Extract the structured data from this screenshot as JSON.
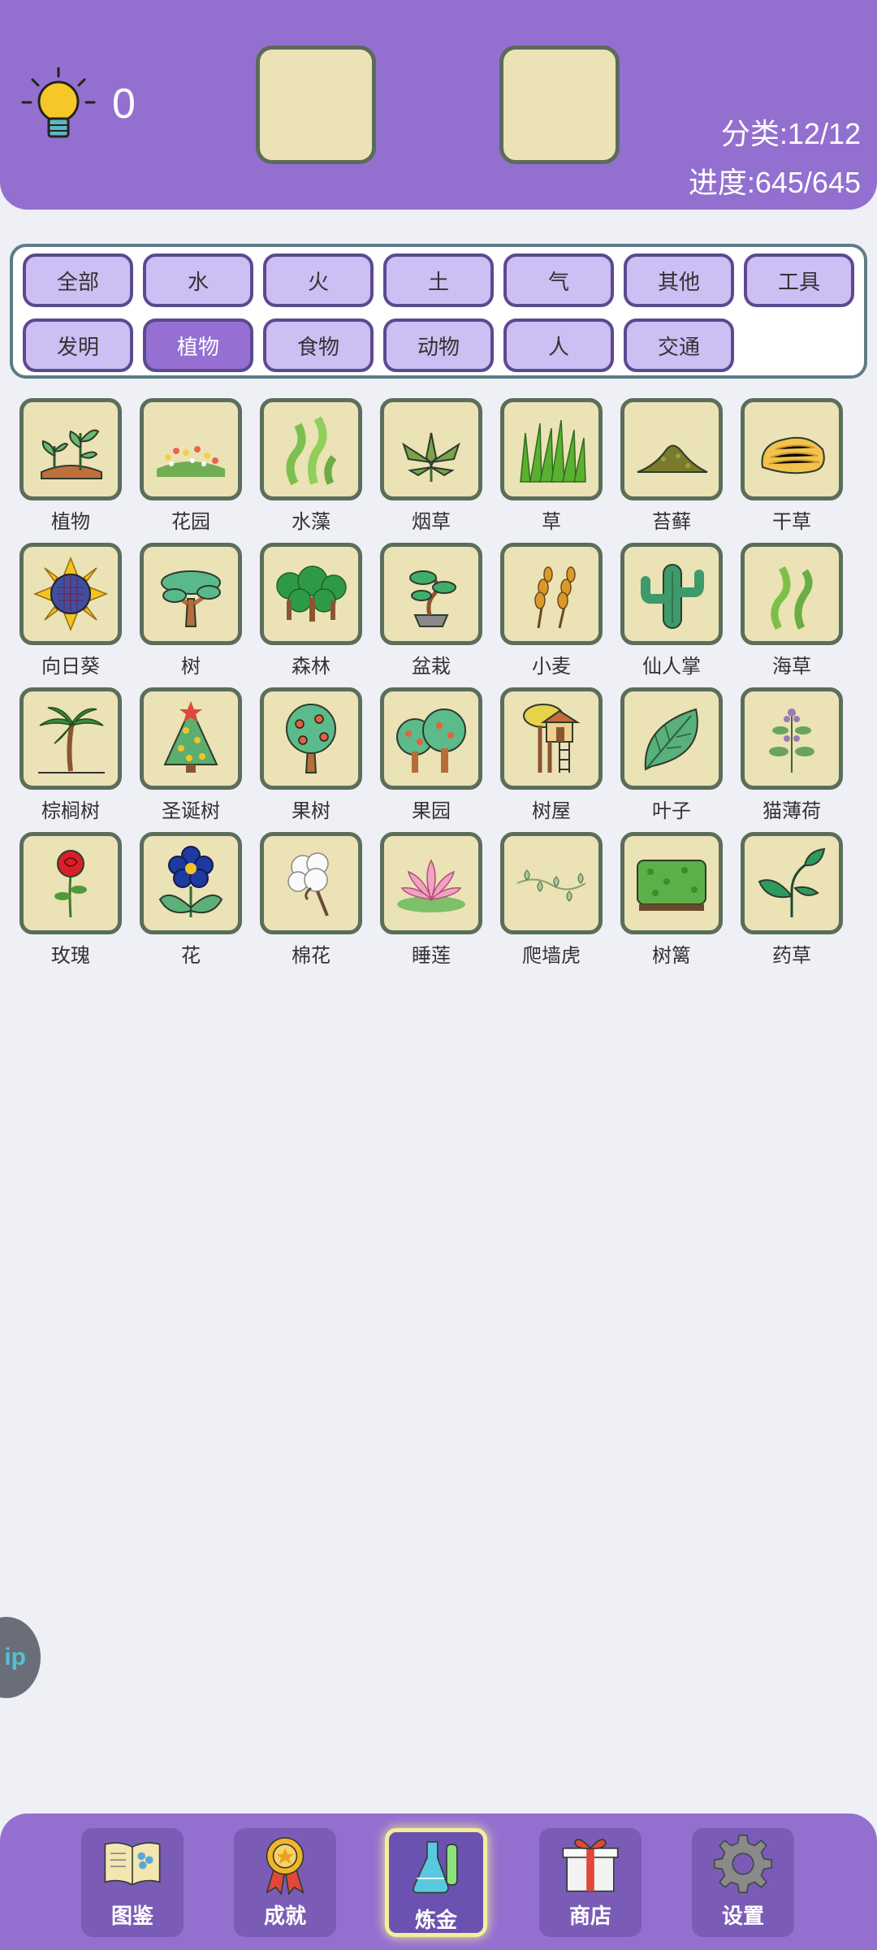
{
  "header": {
    "hint_count": "0",
    "category_stat": "分类:12/12",
    "progress_stat": "进度:645/645"
  },
  "filters": [
    {
      "label": "全部",
      "active": false
    },
    {
      "label": "水",
      "active": false
    },
    {
      "label": "火",
      "active": false
    },
    {
      "label": "土",
      "active": false
    },
    {
      "label": "气",
      "active": false
    },
    {
      "label": "其他",
      "active": false
    },
    {
      "label": "工具",
      "active": false
    },
    {
      "label": "发明",
      "active": false
    },
    {
      "label": "植物",
      "active": true
    },
    {
      "label": "食物",
      "active": false
    },
    {
      "label": "动物",
      "active": false
    },
    {
      "label": "人",
      "active": false
    },
    {
      "label": "交通",
      "active": false
    }
  ],
  "items": [
    {
      "label": "植物",
      "icon": "plant-sprouts-icon"
    },
    {
      "label": "花园",
      "icon": "flower-garden-icon"
    },
    {
      "label": "水藻",
      "icon": "algae-icon"
    },
    {
      "label": "烟草",
      "icon": "tobacco-leaf-icon"
    },
    {
      "label": "草",
      "icon": "grass-icon"
    },
    {
      "label": "苔藓",
      "icon": "moss-mound-icon"
    },
    {
      "label": "干草",
      "icon": "hay-icon"
    },
    {
      "label": "向日葵",
      "icon": "sunflower-icon"
    },
    {
      "label": "树",
      "icon": "tree-icon"
    },
    {
      "label": "森林",
      "icon": "forest-icon"
    },
    {
      "label": "盆栽",
      "icon": "bonsai-icon"
    },
    {
      "label": "小麦",
      "icon": "wheat-icon"
    },
    {
      "label": "仙人掌",
      "icon": "cactus-icon"
    },
    {
      "label": "海草",
      "icon": "seaweed-icon"
    },
    {
      "label": "棕榈树",
      "icon": "palm-tree-icon"
    },
    {
      "label": "圣诞树",
      "icon": "christmas-tree-icon"
    },
    {
      "label": "果树",
      "icon": "fruit-tree-icon"
    },
    {
      "label": "果园",
      "icon": "orchard-icon"
    },
    {
      "label": "树屋",
      "icon": "treehouse-icon"
    },
    {
      "label": "叶子",
      "icon": "leaf-icon"
    },
    {
      "label": "猫薄荷",
      "icon": "catnip-icon"
    },
    {
      "label": "玫瑰",
      "icon": "rose-icon"
    },
    {
      "label": "花",
      "icon": "flower-icon"
    },
    {
      "label": "棉花",
      "icon": "cotton-icon"
    },
    {
      "label": "睡莲",
      "icon": "water-lily-icon"
    },
    {
      "label": "爬墙虎",
      "icon": "ivy-vine-icon"
    },
    {
      "label": "树篱",
      "icon": "hedge-icon"
    },
    {
      "label": "药草",
      "icon": "herb-icon"
    }
  ],
  "floating_button": {
    "text": "ip"
  },
  "bottom_nav": [
    {
      "label": "图鉴",
      "icon": "book-icon",
      "active": false
    },
    {
      "label": "成就",
      "icon": "medal-icon",
      "active": false
    },
    {
      "label": "炼金",
      "icon": "flask-icon",
      "active": true
    },
    {
      "label": "商店",
      "icon": "gift-icon",
      "active": false
    },
    {
      "label": "设置",
      "icon": "gear-icon",
      "active": false
    }
  ],
  "colors": {
    "header": "#9370cf",
    "tile_bg": "#ebe2b6",
    "chip_bg": "#cdbef3",
    "chip_active": "#9570d2"
  }
}
